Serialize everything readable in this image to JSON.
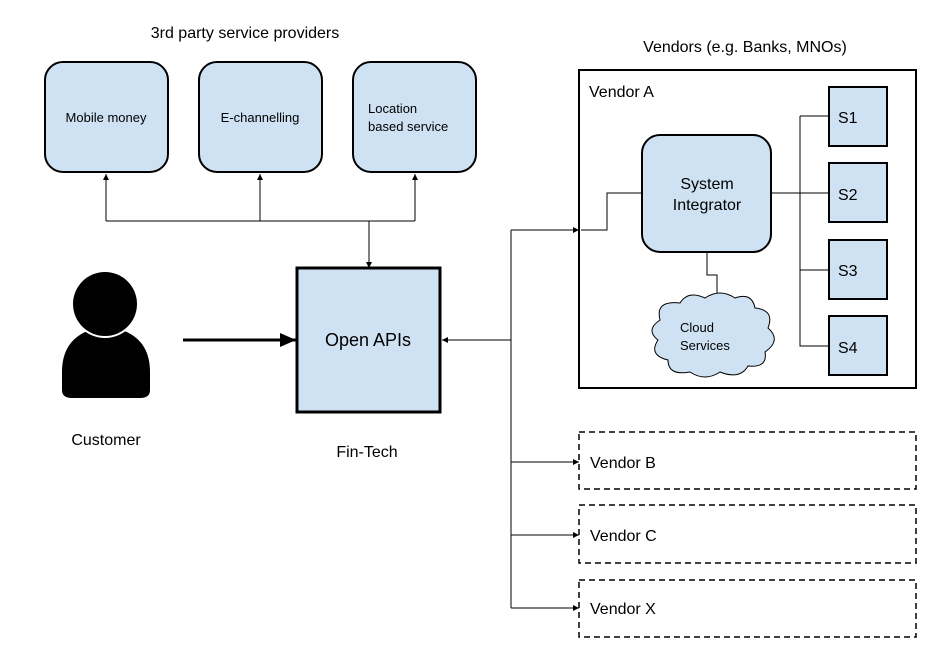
{
  "colors": {
    "box_fill": "#cfe2f3",
    "stroke": "#000000"
  },
  "providers": {
    "title": "3rd party service providers",
    "items": [
      {
        "label": "Mobile money"
      },
      {
        "label": "E-channelling"
      },
      {
        "label_line1": "Location",
        "label_line2": "based service"
      }
    ]
  },
  "customer": {
    "label": "Customer",
    "icon": "person-icon"
  },
  "fintech": {
    "box_label": "Open APIs",
    "label": "Fin-Tech"
  },
  "vendors": {
    "title": "Vendors (e.g. Banks, MNOs)",
    "vendor_a": {
      "label": "Vendor A",
      "integrator_line1": "System",
      "integrator_line2": "Integrator",
      "cloud_line1": "Cloud",
      "cloud_line2": "Services",
      "systems": [
        "S1",
        "S2",
        "S3",
        "S4"
      ]
    },
    "others": [
      "Vendor B",
      "Vendor C",
      "Vendor X"
    ]
  }
}
